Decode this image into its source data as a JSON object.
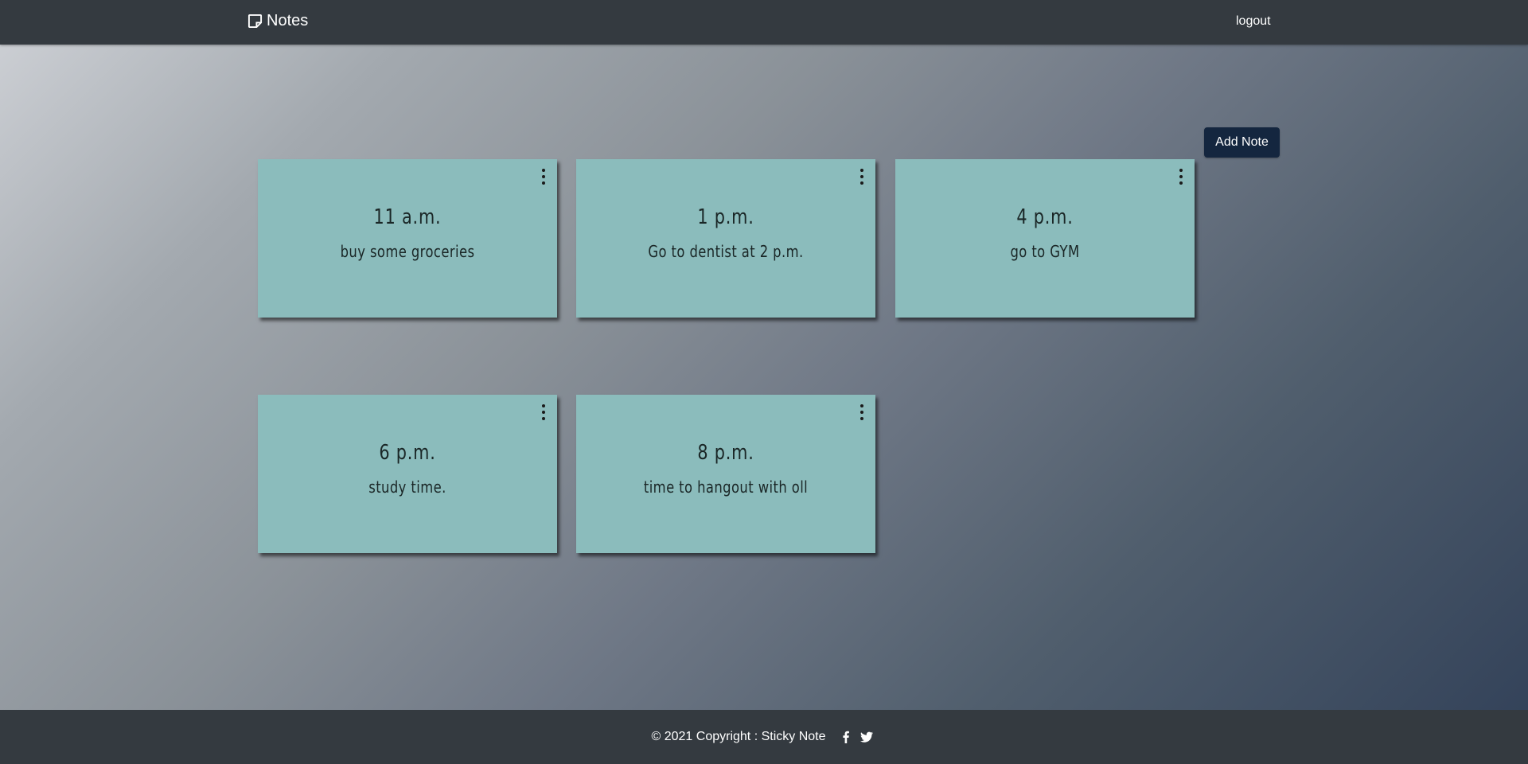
{
  "navbar": {
    "brand": "Notes",
    "logout": "logout"
  },
  "toolbar": {
    "add_note_label": "Add Note"
  },
  "notes": [
    {
      "time": "11 a.m.",
      "text": "buy some groceries"
    },
    {
      "time": "1 p.m.",
      "text": "Go to dentist at 2 p.m."
    },
    {
      "time": "4 p.m.",
      "text": "go to GYM"
    },
    {
      "time": "6 p.m.",
      "text": "study time."
    },
    {
      "time": "8 p.m.",
      "text": "time to hangout with oll"
    }
  ],
  "footer": {
    "copyright": "© 2021 Copyright : Sticky Note"
  },
  "colors": {
    "navbar": "#343a40",
    "note_background": "#8bbcbc",
    "add_note_button": "#14263f"
  },
  "icons": {
    "brand": "sticky-note-icon",
    "note_menu": "vertical-ellipsis-icon",
    "social": [
      "facebook-icon",
      "twitter-icon"
    ]
  }
}
